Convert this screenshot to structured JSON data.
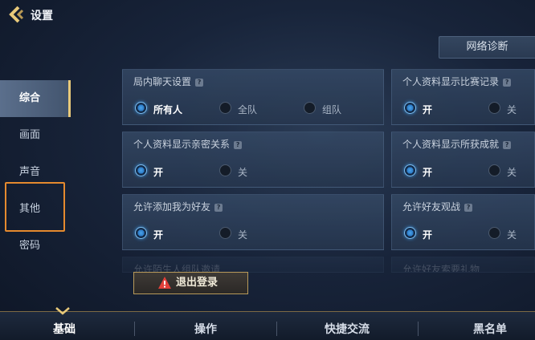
{
  "header": {
    "title": "设置"
  },
  "network_button": "网络诊断",
  "sidebar": {
    "items": [
      {
        "label": "综合"
      },
      {
        "label": "画面"
      },
      {
        "label": "声音"
      },
      {
        "label": "其他"
      },
      {
        "label": "密码"
      }
    ],
    "active_index": 0
  },
  "panels": {
    "chat": {
      "title": "局内聊天设置",
      "options": [
        "所有人",
        "全队",
        "组队"
      ],
      "selected": "所有人"
    },
    "match_record": {
      "title": "个人资料显示比赛记录",
      "options": [
        "开",
        "关"
      ],
      "selected": "开"
    },
    "relationship": {
      "title": "个人资料显示亲密关系",
      "options": [
        "开",
        "关"
      ],
      "selected": "开"
    },
    "achievements": {
      "title": "个人资料显示所获成就",
      "options": [
        "开",
        "关"
      ],
      "selected": "开"
    },
    "add_friend": {
      "title": "允许添加我为好友",
      "options": [
        "开",
        "关"
      ],
      "selected": "开"
    },
    "watch_friend": {
      "title": "允许好友观战",
      "options": [
        "开",
        "关"
      ],
      "selected": "开"
    },
    "stranger_invite": {
      "title": "允许陌生人组队邀请"
    },
    "friend_gift": {
      "title": "允许好友索要礼物"
    }
  },
  "logout_button": "退出登录",
  "bottom_tabs": [
    {
      "label": "基础"
    },
    {
      "label": "操作"
    },
    {
      "label": "快捷交流"
    },
    {
      "label": "黑名单"
    }
  ],
  "icons": {
    "back": "back-arrow-icon",
    "help": "question-icon",
    "warning": "warning-icon"
  },
  "colors": {
    "accent_gold": "#e8c97a",
    "highlight_orange": "#e58a2e",
    "radio_blue": "#4aa3ea",
    "warning_red": "#e2403a"
  }
}
